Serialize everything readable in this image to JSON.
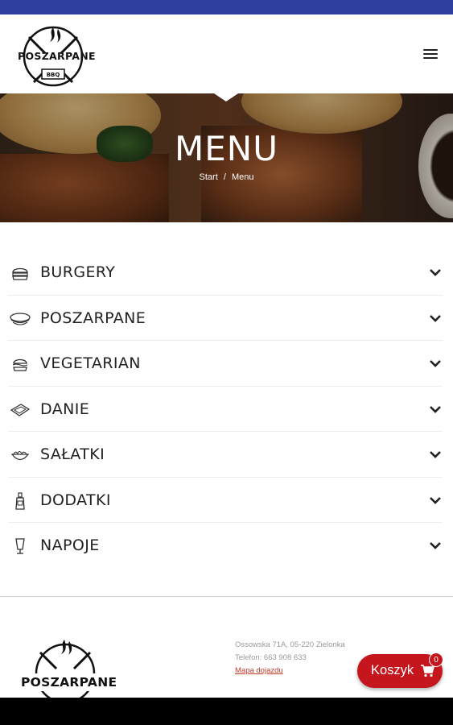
{
  "header": {
    "logo_text": "POSZARPANE",
    "logo_sub": "BBQ"
  },
  "hero": {
    "title": "MENU",
    "breadcrumb": {
      "start": "Start",
      "separator": "/",
      "current": "Menu"
    }
  },
  "menu": {
    "items": [
      {
        "label": "BURGERY",
        "icon": "burger-icon"
      },
      {
        "label": "POSZARPANE",
        "icon": "sandwich-icon"
      },
      {
        "label": "VEGETARIAN",
        "icon": "veggie-burger-icon"
      },
      {
        "label": "DANIE",
        "icon": "dish-icon"
      },
      {
        "label": "SAŁATKI",
        "icon": "salad-bowl-icon"
      },
      {
        "label": "DODATKI",
        "icon": "sauce-bottle-icon"
      },
      {
        "label": "NAPOJE",
        "icon": "drink-glass-icon"
      }
    ]
  },
  "footer": {
    "logo_text": "POSZARPANE",
    "address": "Ossowska 71A, 05-220 Zielonka",
    "phone": "Telefon: 663 908 633",
    "map_link": "Mapa dojazdu"
  },
  "cart": {
    "label": "Koszyk",
    "count": "0"
  },
  "colors": {
    "status_bar": "#2f3fa0",
    "accent_red": "#c4161c"
  }
}
